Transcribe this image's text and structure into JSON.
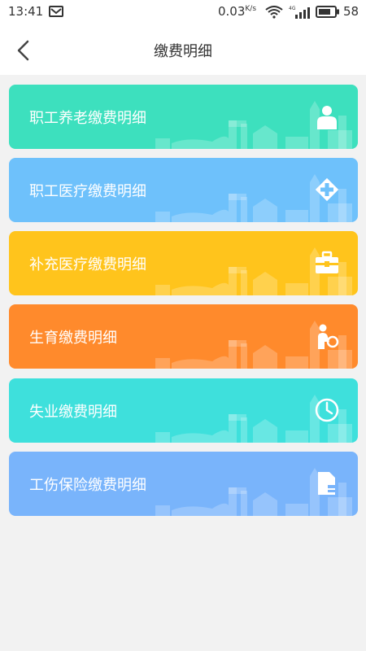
{
  "status_bar": {
    "time": "13:41",
    "speed_value": "0.03",
    "speed_unit": "K/s",
    "network": "4G",
    "battery": "58"
  },
  "header": {
    "title": "缴费明细"
  },
  "cards": [
    {
      "label": "职工养老缴费明细",
      "color": "#3de0be",
      "icon": "person-icon"
    },
    {
      "label": "职工医疗缴费明细",
      "color": "#6ec1fb",
      "icon": "medical-cross-icon"
    },
    {
      "label": "补充医疗缴费明细",
      "color": "#ffc41c",
      "icon": "medical-kit-icon"
    },
    {
      "label": "生育缴费明细",
      "color": "#ff8a2c",
      "icon": "mother-child-icon"
    },
    {
      "label": "失业缴费明细",
      "color": "#3ee0dc",
      "icon": "clock-icon"
    },
    {
      "label": "工伤保险缴费明细",
      "color": "#79b4fb",
      "icon": "document-icon"
    }
  ]
}
